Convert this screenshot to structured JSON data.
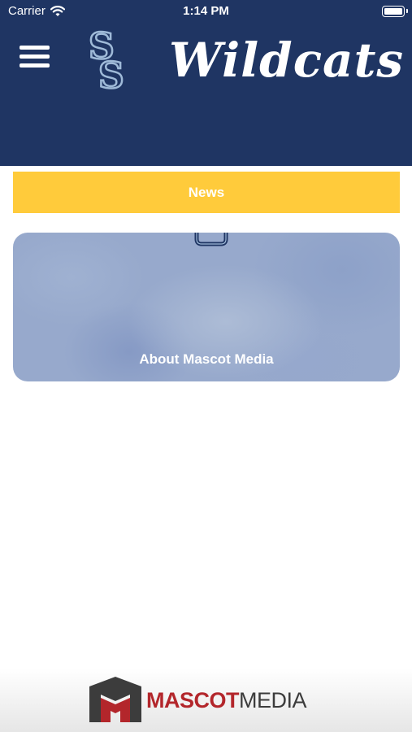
{
  "status_bar": {
    "carrier": "Carrier",
    "time": "1:14 PM"
  },
  "header": {
    "title": "Wildcats",
    "logo_text": "SS"
  },
  "news_button": {
    "label": "News"
  },
  "about_card": {
    "label": "About Mascot Media"
  },
  "footer": {
    "brand_part1": "MASCOT",
    "brand_part2": "MEDIA"
  },
  "colors": {
    "header_bg": "#1f3563",
    "news_yellow": "#ffcb3b",
    "footer_red": "#b3262b",
    "footer_gray": "#3c3c3c"
  },
  "icons": [
    "wifi-icon",
    "battery-icon",
    "hamburger-menu-icon",
    "school-ss-logo",
    "mascot-media-m-logo"
  ]
}
